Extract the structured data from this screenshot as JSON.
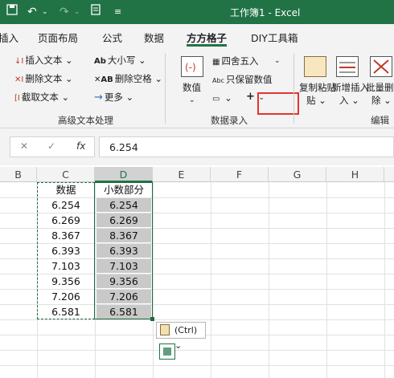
{
  "window": {
    "title": "工作簿1 - Excel",
    "save_icon": "save-icon",
    "undo_icon": "undo-icon",
    "redo_icon": "redo-icon",
    "form_icon": "form-icon"
  },
  "tabs": [
    {
      "label": "插入"
    },
    {
      "label": "页面布局"
    },
    {
      "label": "公式"
    },
    {
      "label": "数据"
    },
    {
      "label": "方方格子"
    },
    {
      "label": "DIY工具箱"
    }
  ],
  "ribbon": {
    "text_group": {
      "label": "高级文本处理",
      "insert_text": "插入文本",
      "delete_text": "删除文本",
      "cut_text": "截取文本",
      "case": "大小写",
      "delete_space": "删除空格",
      "more": "更多"
    },
    "entry_group": {
      "label": "数据录入",
      "value": "数值",
      "round": "四舍五入",
      "keep_value": "只保留数值",
      "plus": "+"
    },
    "edit_group": {
      "label": "编辑",
      "copy_paste": "复制粘贴",
      "add_insert": "新增插入",
      "batch_delete": "批量删除"
    }
  },
  "formula_bar": {
    "cancel": "✕",
    "confirm": "✓",
    "fx": "fx",
    "value": "6.254"
  },
  "columns": [
    "B",
    "C",
    "D",
    "E",
    "F",
    "G",
    "H"
  ],
  "sheet": {
    "c_header": "数据",
    "d_header": "小数部分",
    "c_values": [
      "6.254",
      "6.269",
      "8.367",
      "6.393",
      "7.103",
      "9.356",
      "7.206",
      "6.581"
    ],
    "d_values": [
      "6.254",
      "6.269",
      "8.367",
      "6.393",
      "7.103",
      "9.356",
      "7.206",
      "6.581"
    ]
  },
  "paste_options": {
    "label": "(Ctrl)",
    "icon": "clipboard-icon"
  },
  "colors": {
    "accent": "#217346",
    "highlight": "#e3342f",
    "selected_fill": "#c9c9c9"
  }
}
